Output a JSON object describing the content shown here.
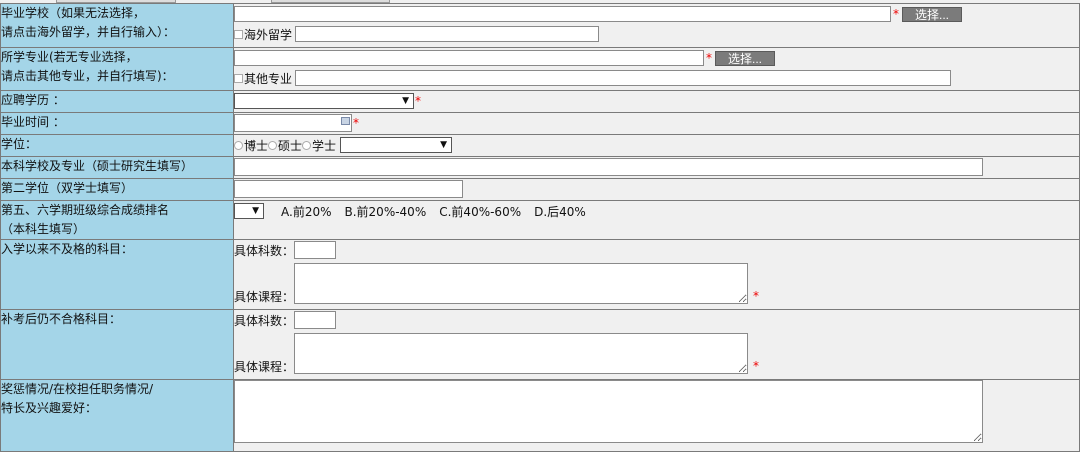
{
  "graduation_school": {
    "label_line1": "毕业学校（如果无法选择，",
    "label_line2": "请点击海外留学，并自行输入）：",
    "choose_button": "选择...",
    "overseas_checkbox_label": "海外留学",
    "required_mark": "*"
  },
  "major": {
    "label_line1": "所学专业(若无专业选择，",
    "label_line2": "请点击其他专业，并自行填写)：",
    "choose_button": "选择...",
    "other_checkbox_label": "其他专业",
    "required_mark": "*"
  },
  "education": {
    "label": "应聘学历 ：",
    "selected_value": "",
    "required_mark": "*"
  },
  "graduation_time": {
    "label": "毕业时间 ：",
    "value": "",
    "required_mark": "*"
  },
  "degree": {
    "label": "学位：",
    "options": [
      "博士",
      "硕士",
      "学士"
    ],
    "selected_value": ""
  },
  "undergrad_school": {
    "label": "本科学校及专业（硕士研究生填写）",
    "value": ""
  },
  "second_degree": {
    "label": "第二学位（双学士填写）",
    "value": ""
  },
  "class_rank": {
    "label_line1": "第五、六学期班级综合成绩排名",
    "label_line2": "（本科生填写）",
    "selected_value": "",
    "choices": [
      "A.前20%",
      "B.前20%-40%",
      "C.前40%-60%",
      "D.后40%"
    ]
  },
  "failed_courses": {
    "label": "入学以来不及格的科目：",
    "count_label": "具体科数：",
    "course_label": "具体课程：",
    "count_value": "",
    "courses_value": "",
    "required_mark": "*"
  },
  "failed_after_retake": {
    "label": "补考后仍不合格科目：",
    "count_label": "具体科数：",
    "course_label": "具体课程：",
    "count_value": "",
    "courses_value": "",
    "required_mark": "*"
  },
  "awards": {
    "label_line1": "奖惩情况/在校担任职务情况/",
    "label_line2": "特长及兴趣爱好：",
    "value": ""
  },
  "colors": {
    "label_bg": "#a4d5e8",
    "field_bg": "#f0f0f0",
    "required": "#e00000",
    "button_bg": "#7b7b7b"
  }
}
